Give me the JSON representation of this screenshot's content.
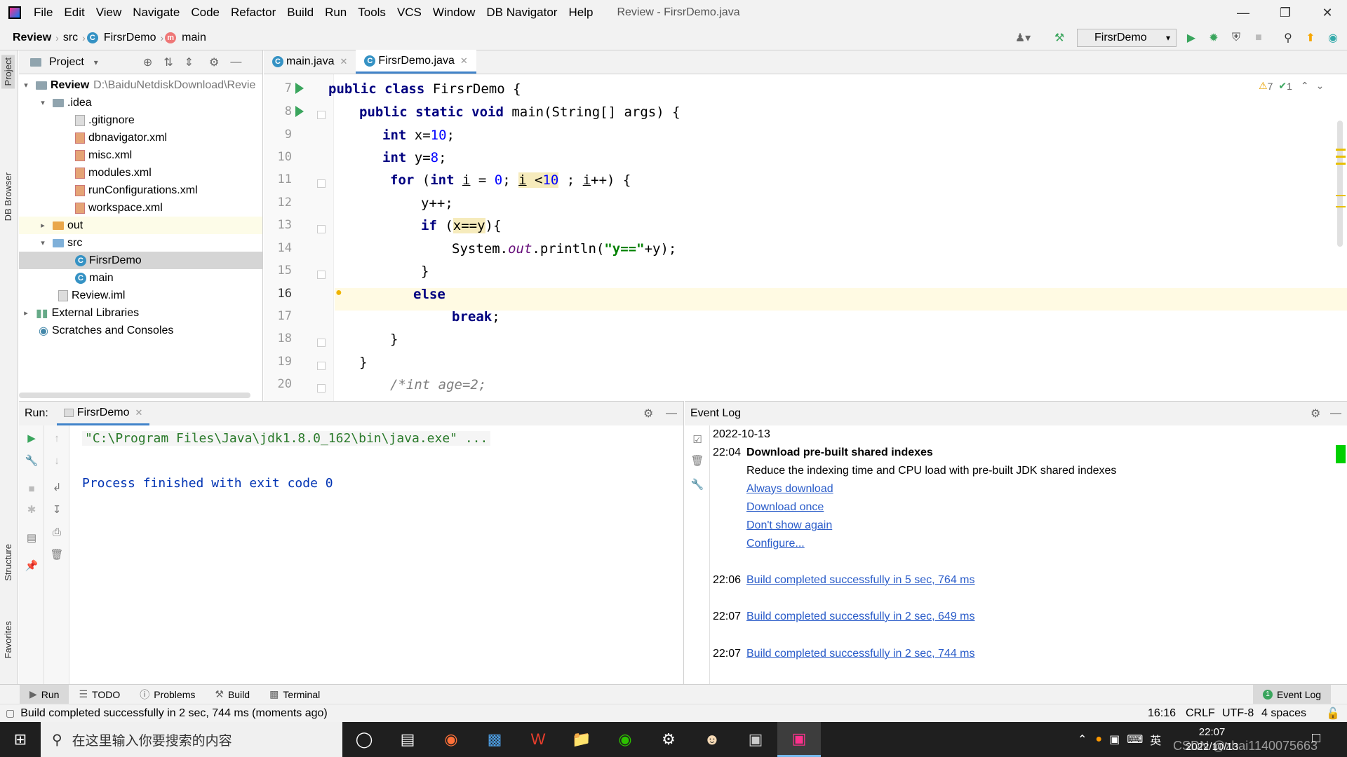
{
  "menubar": {
    "items": [
      "File",
      "Edit",
      "View",
      "Navigate",
      "Code",
      "Refactor",
      "Build",
      "Run",
      "Tools",
      "VCS",
      "Window",
      "DB Navigator",
      "Help"
    ],
    "title": "Review - FirsrDemo.java"
  },
  "navbar": {
    "crumbs": [
      "Review",
      "src",
      "FirsrDemo",
      "main"
    ],
    "run_config": "FirsrDemo"
  },
  "leftstrip": {
    "tabs": [
      "Project",
      "DB Browser",
      "Structure",
      "Favorites"
    ]
  },
  "project": {
    "header": "Project",
    "root_name": "Review",
    "root_path": "D:\\BaiduNetdiskDownload\\Revie",
    "items": [
      {
        "label": ".idea"
      },
      {
        "label": ".gitignore"
      },
      {
        "label": "dbnavigator.xml"
      },
      {
        "label": "misc.xml"
      },
      {
        "label": "modules.xml"
      },
      {
        "label": "runConfigurations.xml"
      },
      {
        "label": "workspace.xml"
      },
      {
        "label": "out"
      },
      {
        "label": "src"
      },
      {
        "label": "FirsrDemo"
      },
      {
        "label": "main"
      },
      {
        "label": "Review.iml"
      },
      {
        "label": "External Libraries"
      },
      {
        "label": "Scratches and Consoles"
      }
    ]
  },
  "editor": {
    "tabs": [
      {
        "label": "main.java"
      },
      {
        "label": "FirsrDemo.java"
      }
    ],
    "warnings": "7",
    "checks": "1",
    "line_numbers": [
      "7",
      "8",
      "9",
      "10",
      "11",
      "12",
      "13",
      "14",
      "15",
      "16",
      "17",
      "18",
      "19",
      "20"
    ]
  },
  "run": {
    "label": "Run:",
    "tab": "FirsrDemo",
    "cmd": "\"C:\\Program Files\\Java\\jdk1.8.0_162\\bin\\java.exe\" ...",
    "exit": "Process finished with exit code 0"
  },
  "eventlog": {
    "title": "Event Log",
    "date": "2022-10-13",
    "t1": "22:04",
    "heading": "Download pre-built shared indexes",
    "desc": "Reduce the indexing time and CPU load with pre-built JDK shared indexes",
    "links": [
      "Always download",
      "Download once",
      "Don't show again",
      "Configure..."
    ],
    "builds": [
      {
        "time": "22:06",
        "text": "Build completed successfully in 5 sec, 764 ms"
      },
      {
        "time": "22:07",
        "text": "Build completed successfully in 2 sec, 649 ms"
      },
      {
        "time": "22:07",
        "text": "Build completed successfully in 2 sec, 744 ms"
      }
    ]
  },
  "bottombar": {
    "tabs": [
      "Run",
      "TODO",
      "Problems",
      "Build",
      "Terminal"
    ],
    "eventlog": "Event Log"
  },
  "status": {
    "message": "Build completed successfully in 2 sec, 744 ms (moments ago)",
    "position": "16:16",
    "line_sep": "CRLF",
    "encoding": "UTF-8",
    "indent": "4 spaces"
  },
  "taskbar": {
    "search_placeholder": "在这里输入你要搜索的内容",
    "time": "22:07",
    "date": "2022/10/13",
    "ime": "英",
    "watermark": "CSDN @zhai1140075663"
  }
}
